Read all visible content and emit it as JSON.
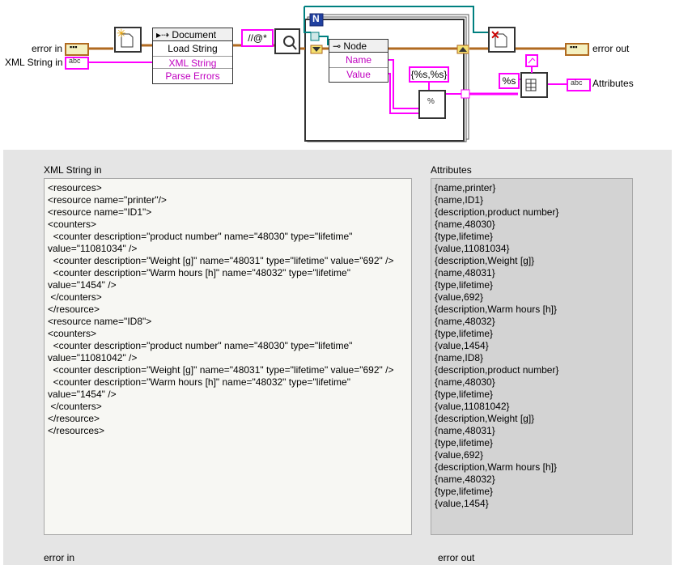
{
  "diagram": {
    "left_labels": {
      "error_in": "error in",
      "xml_string_in": "XML String in"
    },
    "right_labels": {
      "error_out": "error out",
      "attributes": "Attributes"
    },
    "terminal_tags": {
      "error": "▪▪▪",
      "string": "abc"
    },
    "document_node": {
      "title": "Document",
      "properties": [
        "Load String",
        "XML String",
        "Parse Errors"
      ]
    },
    "xpath_constant": "//@*",
    "loop_index": "N",
    "attr_node": {
      "title": "Node",
      "properties": [
        "Name",
        "Value"
      ]
    },
    "format_constant": "{%s,%s}",
    "concat_constant": "%s",
    "colors": {
      "error_wire": "#b06a20",
      "string_wire": "#ff00ff",
      "ref_wire": "#008080",
      "node_header": "#f0f0f0"
    }
  },
  "front_panel": {
    "xml_string_in": {
      "label": "XML String in",
      "value": "<resources>\n<resource name=\"printer\"/>\n<resource name=\"ID1\">\n<counters>\n  <counter description=\"product number\" name=\"48030\" type=\"lifetime\"\nvalue=\"11081034\" />\n  <counter description=\"Weight [g]\" name=\"48031\" type=\"lifetime\" value=\"692\" />\n  <counter description=\"Warm hours [h]\" name=\"48032\" type=\"lifetime\"\nvalue=\"1454\" />\n </counters>\n</resource>\n<resource name=\"ID8\">\n<counters>\n  <counter description=\"product number\" name=\"48030\" type=\"lifetime\"\nvalue=\"11081042\" />\n  <counter description=\"Weight [g]\" name=\"48031\" type=\"lifetime\" value=\"692\" />\n  <counter description=\"Warm hours [h]\" name=\"48032\" type=\"lifetime\"\nvalue=\"1454\" />\n </counters>\n</resource>\n</resources>"
    },
    "attributes": {
      "label": "Attributes",
      "value": "{name,printer}\n{name,ID1}\n{description,product number}\n{name,48030}\n{type,lifetime}\n{value,11081034}\n{description,Weight [g]}\n{name,48031}\n{type,lifetime}\n{value,692}\n{description,Warm hours [h]}\n{name,48032}\n{type,lifetime}\n{value,1454}\n{name,ID8}\n{description,product number}\n{name,48030}\n{type,lifetime}\n{value,11081042}\n{description,Weight [g]}\n{name,48031}\n{type,lifetime}\n{value,692}\n{description,Warm hours [h]}\n{name,48032}\n{type,lifetime}\n{value,1454}"
    },
    "error_in_label": "error in",
    "error_out_label": "error out"
  }
}
